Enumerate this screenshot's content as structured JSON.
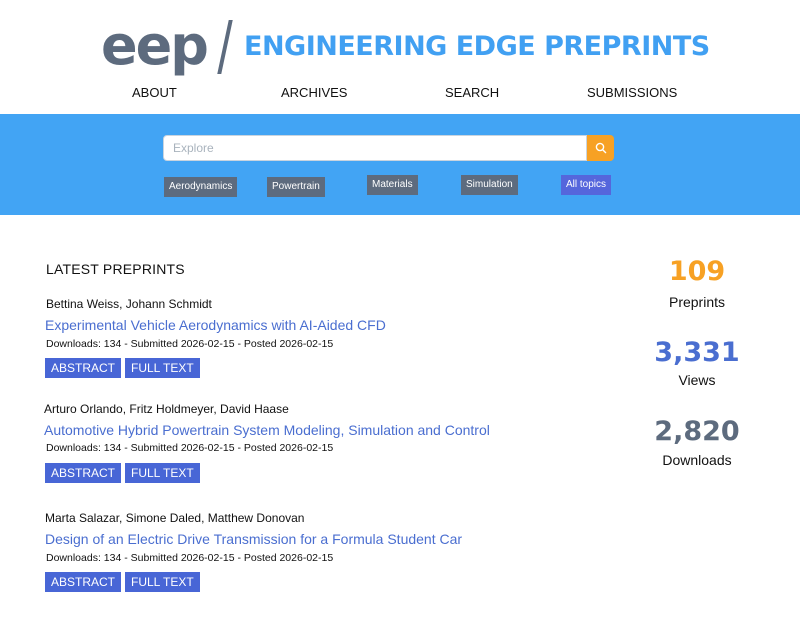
{
  "header": {
    "logo_mark": "eep",
    "site_title": "ENGINEERING EDGE PREPRINTS",
    "nav": [
      "ABOUT",
      "ARCHIVES",
      "SEARCH",
      "SUBMISSIONS"
    ]
  },
  "search": {
    "placeholder": "Explore",
    "button_icon": "search-icon",
    "topics": [
      "Aerodynamics",
      "Powertrain",
      "Materials",
      "Simulation",
      "All topics"
    ]
  },
  "latest": {
    "heading": "LATEST PREPRINTS",
    "entries": [
      {
        "authors": "Bettina Weiss, Johann Schmidt",
        "title": "Experimental Vehicle Aerodynamics with AI-Aided CFD",
        "meta": "Downloads: 134 - Submitted 2026-02-15 - Posted 2026-02-15",
        "abstract_label": "ABSTRACT",
        "fulltext_label": "FULL TEXT"
      },
      {
        "authors": "Arturo Orlando, Fritz Holdmeyer, David Haase",
        "title": "Automotive Hybrid Powertrain System Modeling, Simulation and Control",
        "meta": "Downloads: 134 - Submitted 2026-02-15 - Posted 2026-02-15",
        "abstract_label": "ABSTRACT",
        "fulltext_label": "FULL TEXT"
      },
      {
        "authors": "Marta Salazar, Simone Daled, Matthew Donovan",
        "title": "Design of an Electric Drive Transmission for a Formula Student Car",
        "meta": "Downloads: 134 - Submitted 2026-02-15 - Posted 2026-02-15",
        "abstract_label": "ABSTRACT",
        "fulltext_label": "FULL TEXT"
      }
    ]
  },
  "stats": [
    {
      "value": "109",
      "label": "Preprints"
    },
    {
      "value": "3,331",
      "label": "Views"
    },
    {
      "value": "2,820",
      "label": "Downloads"
    }
  ],
  "colors": {
    "brand_blue": "#41a0f2",
    "band_blue": "#42a4f4",
    "logo_slate": "#5d6b7e",
    "search_orange": "#f7a124",
    "link_blue": "#4a6ed0",
    "button_blue": "#4866d6",
    "chip_accent": "#5566dc",
    "stat_orange": "#f7a124",
    "stat_blue": "#4a6ed0",
    "stat_slate": "#5d6b7e"
  }
}
